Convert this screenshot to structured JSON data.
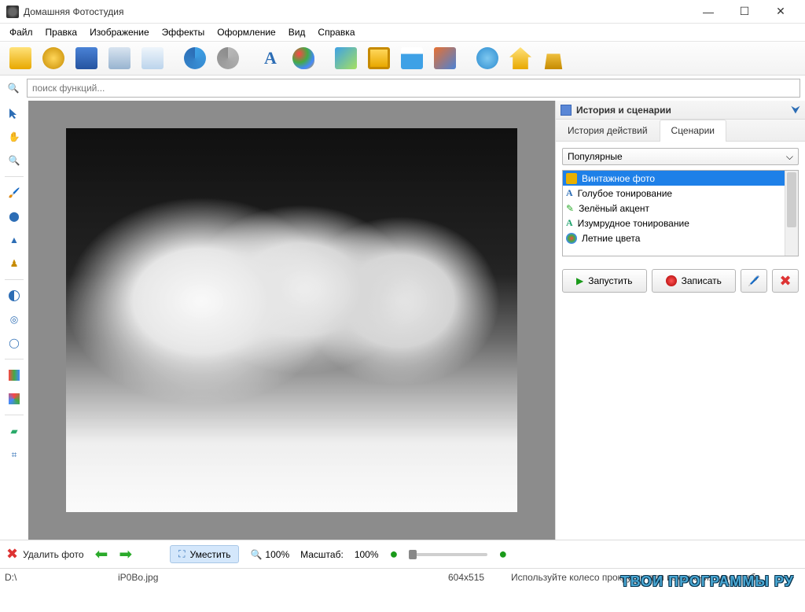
{
  "window": {
    "title": "Домашняя Фотостудия"
  },
  "menu": [
    "Файл",
    "Правка",
    "Изображение",
    "Эффекты",
    "Оформление",
    "Вид",
    "Справка"
  ],
  "search": {
    "placeholder": "поиск функций..."
  },
  "rightPanel": {
    "title": "История и сценарии",
    "tabs": [
      "История действий",
      "Сценарии"
    ],
    "activeTab": 1,
    "filter": "Популярные",
    "items": [
      {
        "label": "Винтажное фото",
        "color": "#e8b000"
      },
      {
        "label": "Голубое тонирование",
        "color": "#2c6db5"
      },
      {
        "label": "Зелёный акцент",
        "color": "#2aaa2a"
      },
      {
        "label": "Изумрудное тонирование",
        "color": "#1fa36e"
      },
      {
        "label": "Летние цвета",
        "color": "#d07a28"
      }
    ],
    "buttons": {
      "run": "Запустить",
      "record": "Записать"
    }
  },
  "bottom": {
    "delete": "Удалить фото",
    "fit": "Уместить",
    "hundred": "100%",
    "scaleLabel": "Масштаб:",
    "scaleValue": "100%"
  },
  "status": {
    "drive": "D:\\",
    "file": "iP0Bo.jpg",
    "dims": "604x515",
    "hint": "Используйте колесо прокрутки для изменения масштаба"
  },
  "watermark": "ТВОИ ПРОГРАММЫ РУ"
}
